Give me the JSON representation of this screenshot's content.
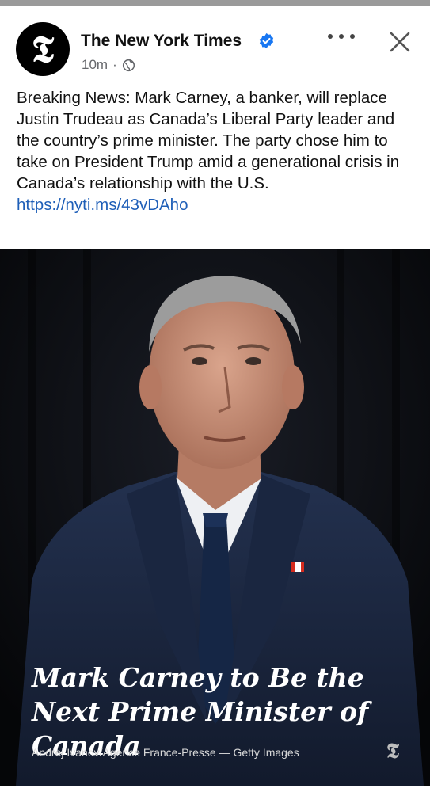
{
  "post": {
    "page_name": "The New York Times",
    "avatar_glyph": "𝕿",
    "time": "10m",
    "separator": "·",
    "icons": {
      "verified": "verified-badge-icon",
      "audience": "globe-icon",
      "more": "more-options-icon",
      "close": "close-icon"
    },
    "text_body": "Breaking News: Mark Carney, a banker, will replace Justin Trudeau as Canada’s Liberal Party leader and the country’s prime minister. The party chose him to take on President Trump amid a generational crisis in Canada’s relationship with the U.S. ",
    "link": "https://nyti.ms/43vDAho"
  },
  "media": {
    "headline": "Mark Carney to Be the Next Prime Minister of Canada",
    "credit": "Andrej Ivanov/Agence France-Presse — Getty Images",
    "watermark_glyph": "𝕿"
  },
  "colors": {
    "verified_blue": "#1877f2",
    "link_blue": "#1f5fb8",
    "photo_background": "#0b0c10"
  }
}
